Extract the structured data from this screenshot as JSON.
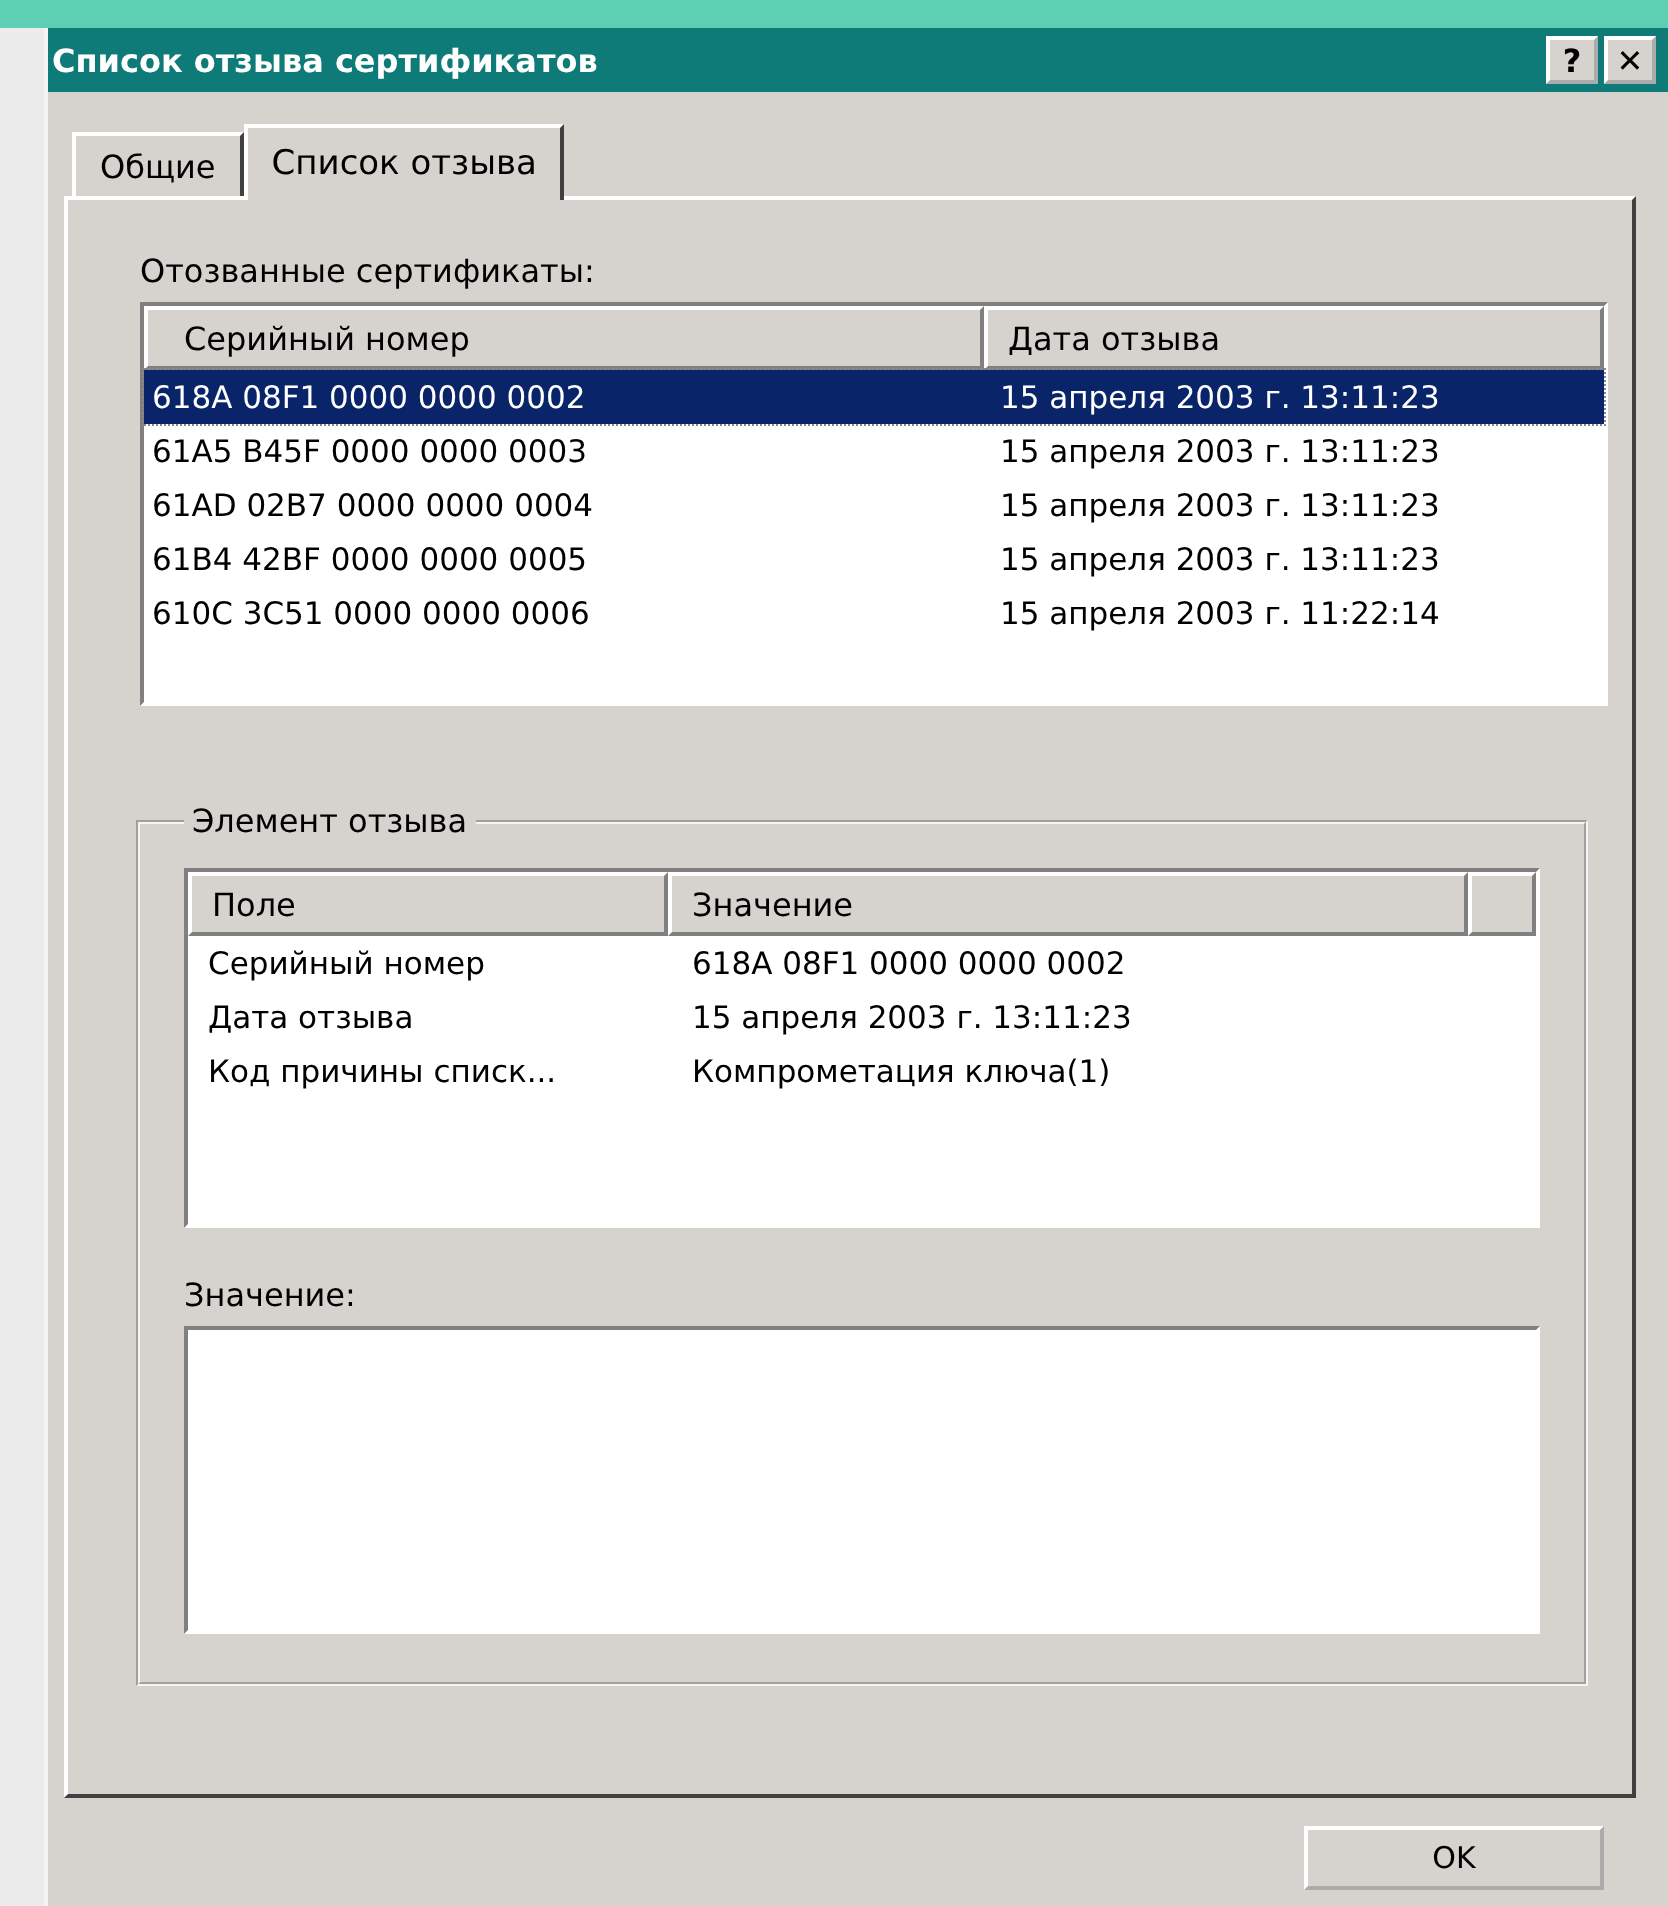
{
  "window": {
    "title": "Список отзыва сертификатов",
    "title_buttons": [
      "?",
      "✕"
    ]
  },
  "tabs": [
    {
      "label": "Общие",
      "selected": false
    },
    {
      "label": "Список отзыва",
      "selected": true
    }
  ],
  "revoked": {
    "label": "Отозванные сертификаты:",
    "columns": [
      "Серийный номер",
      "Дата отзыва"
    ],
    "rows": [
      {
        "serial": "618A 08F1 0000 0000 0002",
        "date": "15 апреля 2003 г. 13:11:23",
        "selected": true
      },
      {
        "serial": "61A5 B45F 0000 0000 0003",
        "date": "15 апреля 2003 г. 13:11:23",
        "selected": false
      },
      {
        "serial": "61AD 02B7 0000 0000 0004",
        "date": "15 апреля 2003 г. 13:11:23",
        "selected": false
      },
      {
        "serial": "61B4 42BF 0000 0000 0005",
        "date": "15 апреля 2003 г. 13:11:23",
        "selected": false
      },
      {
        "serial": "610C 3C51 0000 0000 0006",
        "date": "15 апреля 2003 г. 11:22:14",
        "selected": false
      }
    ]
  },
  "entry": {
    "legend": "Элемент отзыва",
    "columns": [
      "Поле",
      "Значение"
    ],
    "rows": [
      {
        "field": "Серийный номер",
        "value": "618A 08F1 0000 0000 0002"
      },
      {
        "field": "Дата отзыва",
        "value": "15 апреля 2003 г. 13:11:23"
      },
      {
        "field": "Код причины списк...",
        "value": "Компрометация ключа(1)"
      }
    ],
    "value_label": "Значение:"
  },
  "buttons": [
    "OK"
  ]
}
